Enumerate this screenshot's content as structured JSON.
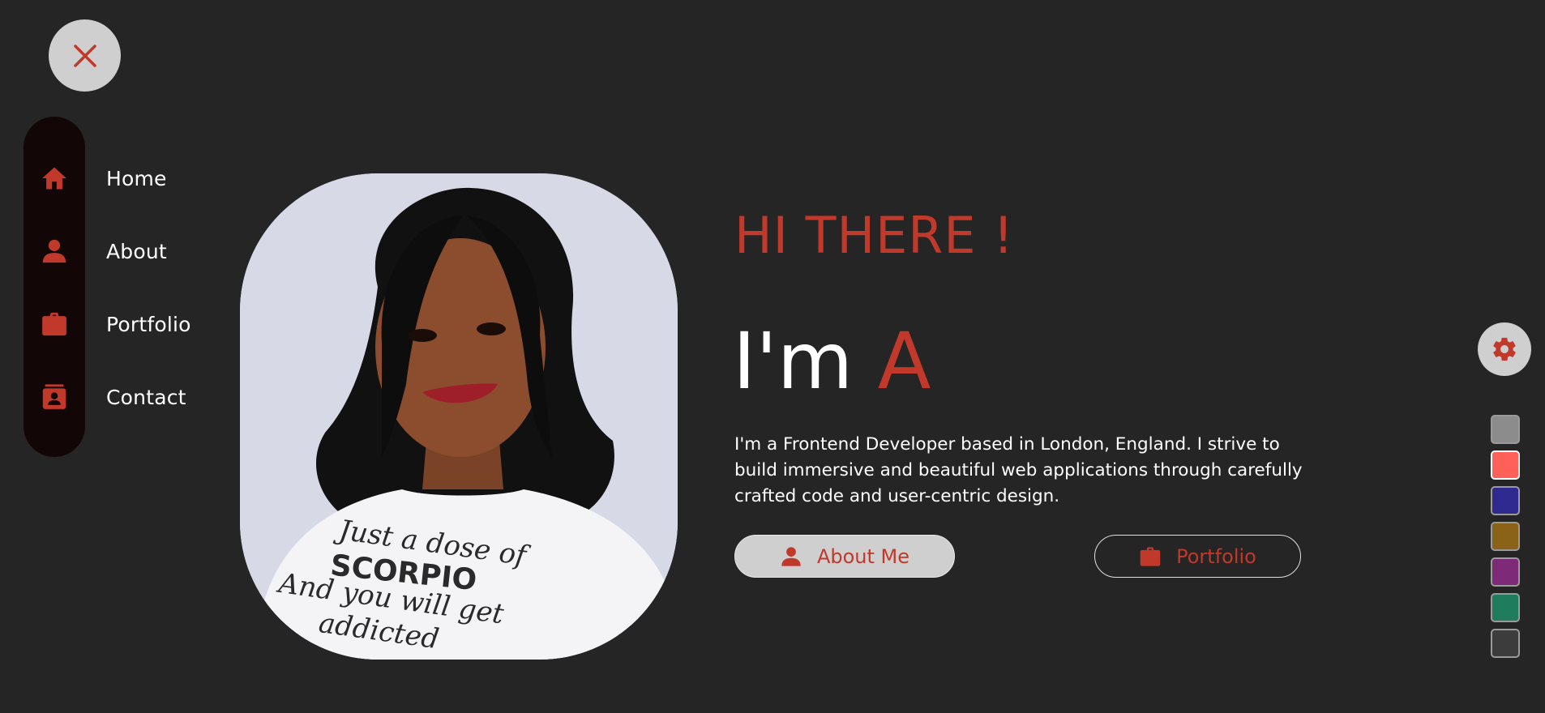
{
  "colors": {
    "background": "#252525",
    "accent": "#c0392b",
    "button_light": "#cfcfcf",
    "nav_pill": "#130606"
  },
  "close_button": {
    "icon": "close-icon"
  },
  "nav": {
    "items": [
      {
        "label": "Home",
        "icon": "home-icon"
      },
      {
        "label": "About",
        "icon": "user-icon"
      },
      {
        "label": "Portfolio",
        "icon": "briefcase-icon"
      },
      {
        "label": "Contact",
        "icon": "contact-card-icon"
      }
    ]
  },
  "hero": {
    "greeting": "HI THERE !",
    "headline_prefix": "I'm",
    "headline_name": "A",
    "intro": "I'm a Frontend Developer based in London, England. I strive to build immersive and beautiful web applications through carefully crafted code and user-centric design.",
    "shirt_text": [
      "Just a dose of",
      "SCORPIO",
      "And you will get",
      "addicted"
    ]
  },
  "buttons": {
    "about": {
      "label": "About Me",
      "icon": "user-icon"
    },
    "portfolio": {
      "label": "Portfolio",
      "icon": "briefcase-icon"
    }
  },
  "settings": {
    "icon": "gear-icon"
  },
  "theme_swatches": [
    {
      "color": "#8c8c8c",
      "selected": false
    },
    {
      "color": "#ff6058",
      "selected": true
    },
    {
      "color": "#2e2a8f",
      "selected": false
    },
    {
      "color": "#8a6218",
      "selected": false
    },
    {
      "color": "#7d2b78",
      "selected": false
    },
    {
      "color": "#1f7c5c",
      "selected": false
    },
    {
      "color": "#3c3c3c",
      "selected": false
    }
  ]
}
